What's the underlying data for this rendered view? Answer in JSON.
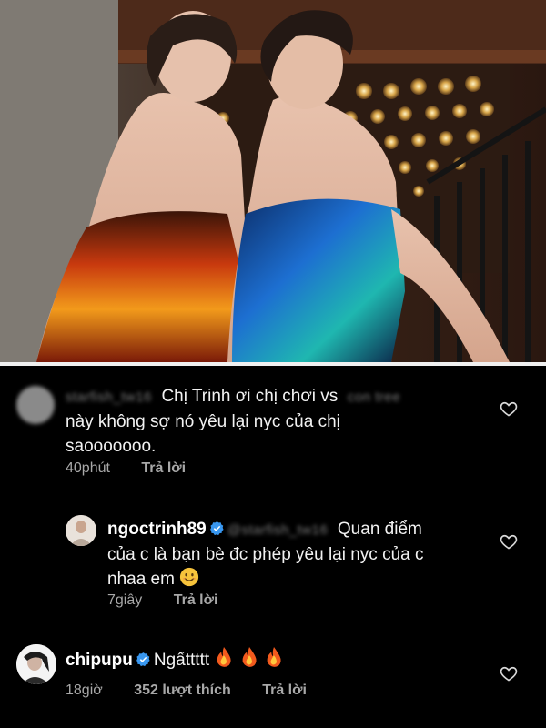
{
  "comments": [
    {
      "username": "starfish_tw16",
      "mention": "con tree",
      "text_line1_a": "Chị Trinh ơi chị chơi vs",
      "text_line2": "này không sợ nó yêu lại nyc của chị",
      "text_line3": "saooooooo.",
      "time": "40phút",
      "reply_label": "Trả lời",
      "verified": false
    },
    {
      "username": "ngoctrinh89",
      "mention": "@starfish_tw16",
      "text_line1": "Quan điểm",
      "text_line2": "của c là bạn bè đc phép yêu lại nyc của c",
      "text_line3": "nhaa em",
      "time": "7giây",
      "reply_label": "Trả lời",
      "verified": true
    },
    {
      "username": "chipupu",
      "text": "Ngấttttt",
      "time": "18giờ",
      "likes": "352 lượt thích",
      "reply_label": "Trả lời",
      "verified": true
    }
  ],
  "icons": {
    "heart": "heart-outline-icon",
    "verified": "verified-badge-icon",
    "smile": "smiling-face-emoji",
    "fire": "fire-emoji"
  },
  "colors": {
    "background": "#000000",
    "verified_blue": "#3897f0",
    "meta_gray": "#a8a8a8"
  }
}
